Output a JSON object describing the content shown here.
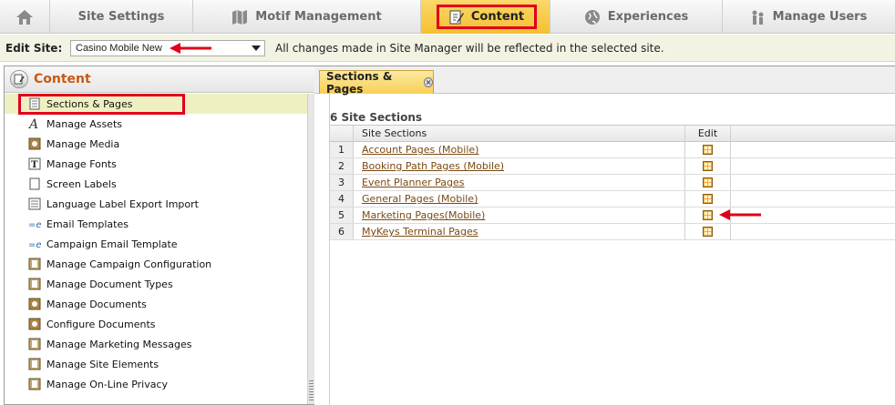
{
  "nav": {
    "home_icon": "home-icon",
    "tabs": [
      {
        "label": "Site Settings",
        "icon": ""
      },
      {
        "label": "Motif Management",
        "icon": "motif-icon"
      },
      {
        "label": "Content",
        "icon": "content-icon"
      },
      {
        "label": "Experiences",
        "icon": "globe-icon"
      },
      {
        "label": "Manage Users",
        "icon": "users-icon"
      }
    ],
    "active_color": "#f4c030"
  },
  "editbar": {
    "label": "Edit Site:",
    "selected_site": "Casino Mobile New",
    "note": "All changes made in Site Manager will be reflected in the selected site."
  },
  "leftpanel": {
    "title": "Content",
    "items": [
      {
        "label": "Sections & Pages",
        "icon": "page-icon"
      },
      {
        "label": "Manage Assets",
        "icon": "font-a-icon"
      },
      {
        "label": "Manage Media",
        "icon": "media-icon"
      },
      {
        "label": "Manage Fonts",
        "icon": "font-t-icon"
      },
      {
        "label": "Screen Labels",
        "icon": "page-icon"
      },
      {
        "label": "Language Label Export Import",
        "icon": "list-icon"
      },
      {
        "label": "Email Templates",
        "icon": "email-icon"
      },
      {
        "label": "Campaign Email Template",
        "icon": "email-icon"
      },
      {
        "label": "Manage Campaign Configuration",
        "icon": "doc-stack-icon"
      },
      {
        "label": "Manage Document Types",
        "icon": "doc-stack-icon"
      },
      {
        "label": "Manage Documents",
        "icon": "media-icon"
      },
      {
        "label": "Configure Documents",
        "icon": "media-icon"
      },
      {
        "label": "Manage Marketing Messages",
        "icon": "doc-stack-icon"
      },
      {
        "label": "Manage Site Elements",
        "icon": "doc-stack-icon"
      },
      {
        "label": "Manage On-Line Privacy",
        "icon": "doc-stack-icon"
      }
    ]
  },
  "rightpanel": {
    "tab_label": "Sections & Pages",
    "heading": "6 Site Sections",
    "columns": {
      "name": "Site Sections",
      "edit": "Edit"
    },
    "rows": [
      {
        "num": "1",
        "name": "Account Pages (Mobile)"
      },
      {
        "num": "2",
        "name": "Booking Path Pages (Mobile)"
      },
      {
        "num": "3",
        "name": "Event Planner Pages"
      },
      {
        "num": "4",
        "name": "General Pages (Mobile)"
      },
      {
        "num": "5",
        "name": "Marketing Pages(Mobile)"
      },
      {
        "num": "6",
        "name": "MyKeys Terminal Pages"
      }
    ]
  },
  "colors": {
    "highlight": "#e0001a",
    "link": "#7a4a12",
    "title": "#c85a12"
  }
}
